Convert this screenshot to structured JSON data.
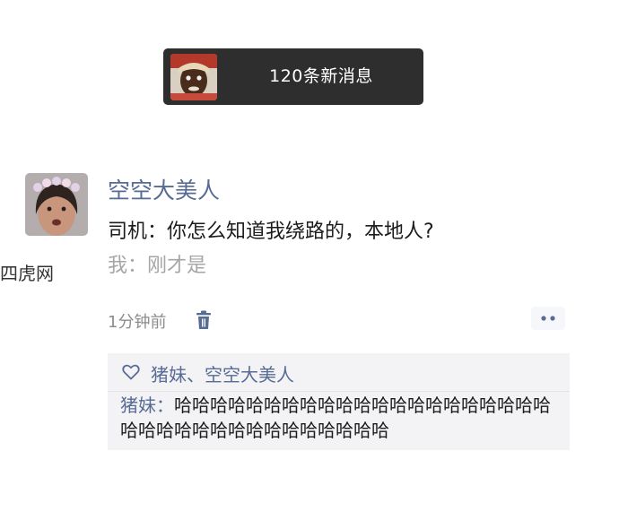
{
  "notification": {
    "text": "120条新消息"
  },
  "post": {
    "author": "空空大美人",
    "lines": [
      "司机：你怎么知道我绕路的，本地人?",
      "我：刚才是"
    ],
    "time": "1分钟前"
  },
  "likes": {
    "users": "猪妹、空空大美人"
  },
  "comments": [
    {
      "user": "猪妹",
      "separator": "：",
      "text": "哈哈哈哈哈哈哈哈哈哈哈哈哈哈哈哈哈哈哈哈哈哈哈哈哈哈哈哈哈哈哈哈哈哈哈哈"
    }
  ],
  "watermark": "四虎网",
  "colors": {
    "link": "#576b95",
    "notification_bg": "#2e2e2e",
    "interaction_bg": "#f3f3f5",
    "secondary_text": "#a6a6a6"
  },
  "icons": [
    "trash-icon",
    "heart-icon",
    "more-dots-icon"
  ]
}
